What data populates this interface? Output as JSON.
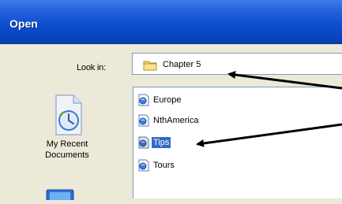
{
  "window": {
    "title": "Open"
  },
  "lookin": {
    "label": "Look in:",
    "value": "Chapter 5"
  },
  "places": {
    "recent_label": "My Recent\nDocuments"
  },
  "files": [
    {
      "name": "Europe",
      "selected": false
    },
    {
      "name": "NthAmerica",
      "selected": false
    },
    {
      "name": "Tips",
      "selected": true
    },
    {
      "name": "Tours",
      "selected": false
    }
  ],
  "colors": {
    "title_bar": "#0d4fd1",
    "selection": "#316ac5",
    "arrow": "#000000"
  }
}
